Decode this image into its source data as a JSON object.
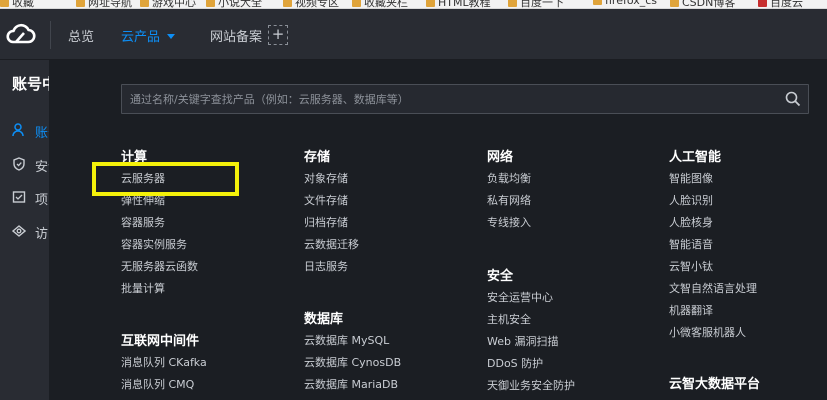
{
  "bookmarks": [
    {
      "label": "收藏"
    },
    {
      "label": "网址导航"
    },
    {
      "label": "游戏中心"
    },
    {
      "label": "小说大全"
    },
    {
      "label": "视频专区"
    },
    {
      "label": "收藏夹栏"
    },
    {
      "label": "HTML教程"
    },
    {
      "label": "百度一下"
    },
    {
      "label": "firefox_cs"
    },
    {
      "label": "CSDN博客"
    },
    {
      "label": "百度云"
    }
  ],
  "topbar": {
    "overview": "总览",
    "products": "云产品",
    "beian": "网站备案",
    "add": "+"
  },
  "sidebar": {
    "title": "账号中心",
    "items": [
      {
        "label": "账号信息",
        "icon": "user-icon"
      },
      {
        "label": "安全设置",
        "icon": "shield-icon"
      },
      {
        "label": "项目管理",
        "icon": "project-icon"
      },
      {
        "label": "访问管理",
        "icon": "access-icon"
      }
    ]
  },
  "search": {
    "placeholder": "通过名称/关键字查找产品（例如：云服务器、数据库等）"
  },
  "columns": [
    {
      "groups": [
        {
          "title": "计算",
          "items": [
            "云服务器",
            "弹性伸缩",
            "容器服务",
            "容器实例服务",
            "无服务器云函数",
            "批量计算"
          ]
        },
        {
          "title": "互联网中间件",
          "items": [
            "消息队列 CKafka",
            "消息队列 CMQ"
          ]
        }
      ]
    },
    {
      "groups": [
        {
          "title": "存储",
          "items": [
            "对象存储",
            "文件存储",
            "归档存储",
            "云数据迁移",
            "日志服务"
          ]
        },
        {
          "title": "数据库",
          "items": [
            "云数据库 MySQL",
            "云数据库 CynosDB",
            "云数据库 MariaDB"
          ]
        }
      ]
    },
    {
      "groups": [
        {
          "title": "网络",
          "items": [
            "负载均衡",
            "私有网络",
            "专线接入"
          ]
        },
        {
          "title": "安全",
          "items": [
            "安全运营中心",
            "主机安全",
            "Web 漏洞扫描",
            "DDoS 防护",
            "天御业务安全防护"
          ]
        }
      ]
    },
    {
      "groups": [
        {
          "title": "人工智能",
          "items": [
            "智能图像",
            "人脸识别",
            "人脸核身",
            "智能语音",
            "云智小钛",
            "文智自然语言处理",
            "机器翻译",
            "小微客服机器人"
          ]
        },
        {
          "title": "云智大数据平台",
          "items": []
        }
      ]
    }
  ],
  "colors": {
    "accent": "#0d8ef5",
    "highlight": "#f4f10a",
    "panel_bg": "#1b1e23",
    "nav_bg": "#292c33"
  }
}
